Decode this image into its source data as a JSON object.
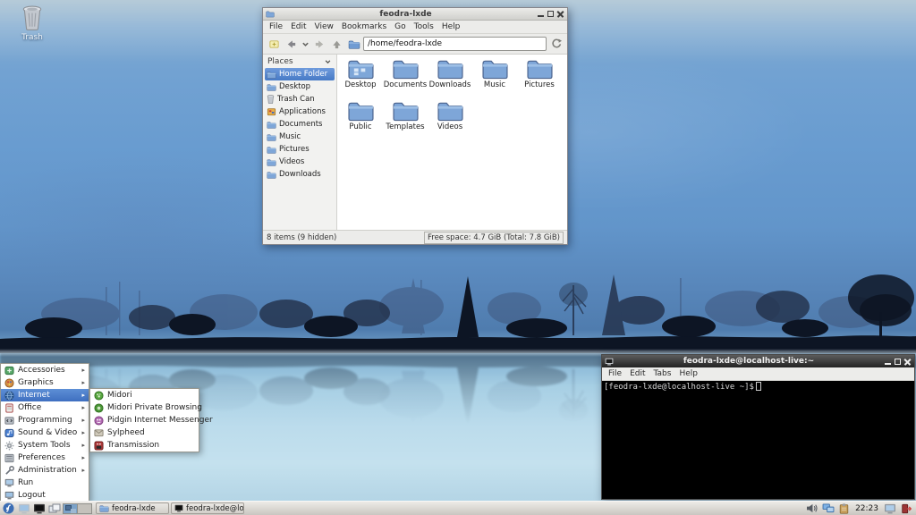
{
  "theme": {
    "selection_blue": "#4a7acb",
    "folder_blue": "#7ea6d8",
    "titlebar_active": "#2b2b2b",
    "titlebar_inactive": "#d6d6d2",
    "water_blue": "#bcdcec",
    "treeline": "#0d1524"
  },
  "desktop": {
    "trash_label": "Trash"
  },
  "file_manager": {
    "title": "feodra-lxde",
    "menu_items": [
      "File",
      "Edit",
      "View",
      "Bookmarks",
      "Go",
      "Tools",
      "Help"
    ],
    "path": "/home/feodra-lxde",
    "places_header": "Places",
    "sidebar_items": [
      {
        "label": "Home Folder",
        "icon": "home-folder-icon",
        "selected": true
      },
      {
        "label": "Desktop",
        "icon": "folder-icon",
        "selected": false
      },
      {
        "label": "Trash Can",
        "icon": "trash-small-icon",
        "selected": false
      },
      {
        "label": "Applications",
        "icon": "applications-icon",
        "selected": false
      },
      {
        "label": "Documents",
        "icon": "folder-icon",
        "selected": false
      },
      {
        "label": "Music",
        "icon": "folder-icon",
        "selected": false
      },
      {
        "label": "Pictures",
        "icon": "folder-icon",
        "selected": false
      },
      {
        "label": "Videos",
        "icon": "folder-icon",
        "selected": false
      },
      {
        "label": "Downloads",
        "icon": "folder-icon",
        "selected": false
      }
    ],
    "folders": [
      "Desktop",
      "Documents",
      "Downloads",
      "Music",
      "Pictures",
      "Public",
      "Templates",
      "Videos"
    ],
    "status_left": "8 items (9 hidden)",
    "status_right": "Free space: 4.7 GiB (Total: 7.8 GiB)"
  },
  "terminal": {
    "title": "feodra-lxde@localhost-live:~",
    "menu_items": [
      "File",
      "Edit",
      "Tabs",
      "Help"
    ],
    "prompt": "[feodra-lxde@localhost-live ~]$"
  },
  "app_menu": {
    "items": [
      {
        "label": "Accessories",
        "icon": "accessories-icon",
        "submenu": true,
        "highlighted": false
      },
      {
        "label": "Graphics",
        "icon": "graphics-icon",
        "submenu": true,
        "highlighted": false
      },
      {
        "label": "Internet",
        "icon": "internet-icon",
        "submenu": true,
        "highlighted": true
      },
      {
        "label": "Office",
        "icon": "office-icon",
        "submenu": true,
        "highlighted": false
      },
      {
        "label": "Programming",
        "icon": "programming-icon",
        "submenu": true,
        "highlighted": false
      },
      {
        "label": "Sound & Video",
        "icon": "sound-video-icon",
        "submenu": true,
        "highlighted": false
      },
      {
        "label": "System Tools",
        "icon": "system-tools-icon",
        "submenu": true,
        "highlighted": false
      },
      {
        "label": "Preferences",
        "icon": "preferences-icon",
        "submenu": true,
        "highlighted": false
      },
      {
        "label": "Administration",
        "icon": "administration-icon",
        "submenu": true,
        "highlighted": false
      },
      {
        "label": "Run",
        "icon": "run-icon",
        "submenu": false,
        "highlighted": false
      },
      {
        "label": "Logout",
        "icon": "logout-menu-icon",
        "submenu": false,
        "highlighted": false
      }
    ],
    "submenu_items": [
      {
        "label": "Midori",
        "icon": "midori-icon"
      },
      {
        "label": "Midori Private Browsing",
        "icon": "midori-private-icon"
      },
      {
        "label": "Pidgin Internet Messenger",
        "icon": "pidgin-icon"
      },
      {
        "label": "Sylpheed",
        "icon": "sylpheed-icon"
      },
      {
        "label": "Transmission",
        "icon": "transmission-icon"
      }
    ]
  },
  "taskbar": {
    "tasks": [
      {
        "label": "feodra-lxde",
        "icon": "folder-icon"
      },
      {
        "label": "feodra-lxde@loc...",
        "icon": "terminal-icon"
      }
    ],
    "clock": "22:23"
  }
}
